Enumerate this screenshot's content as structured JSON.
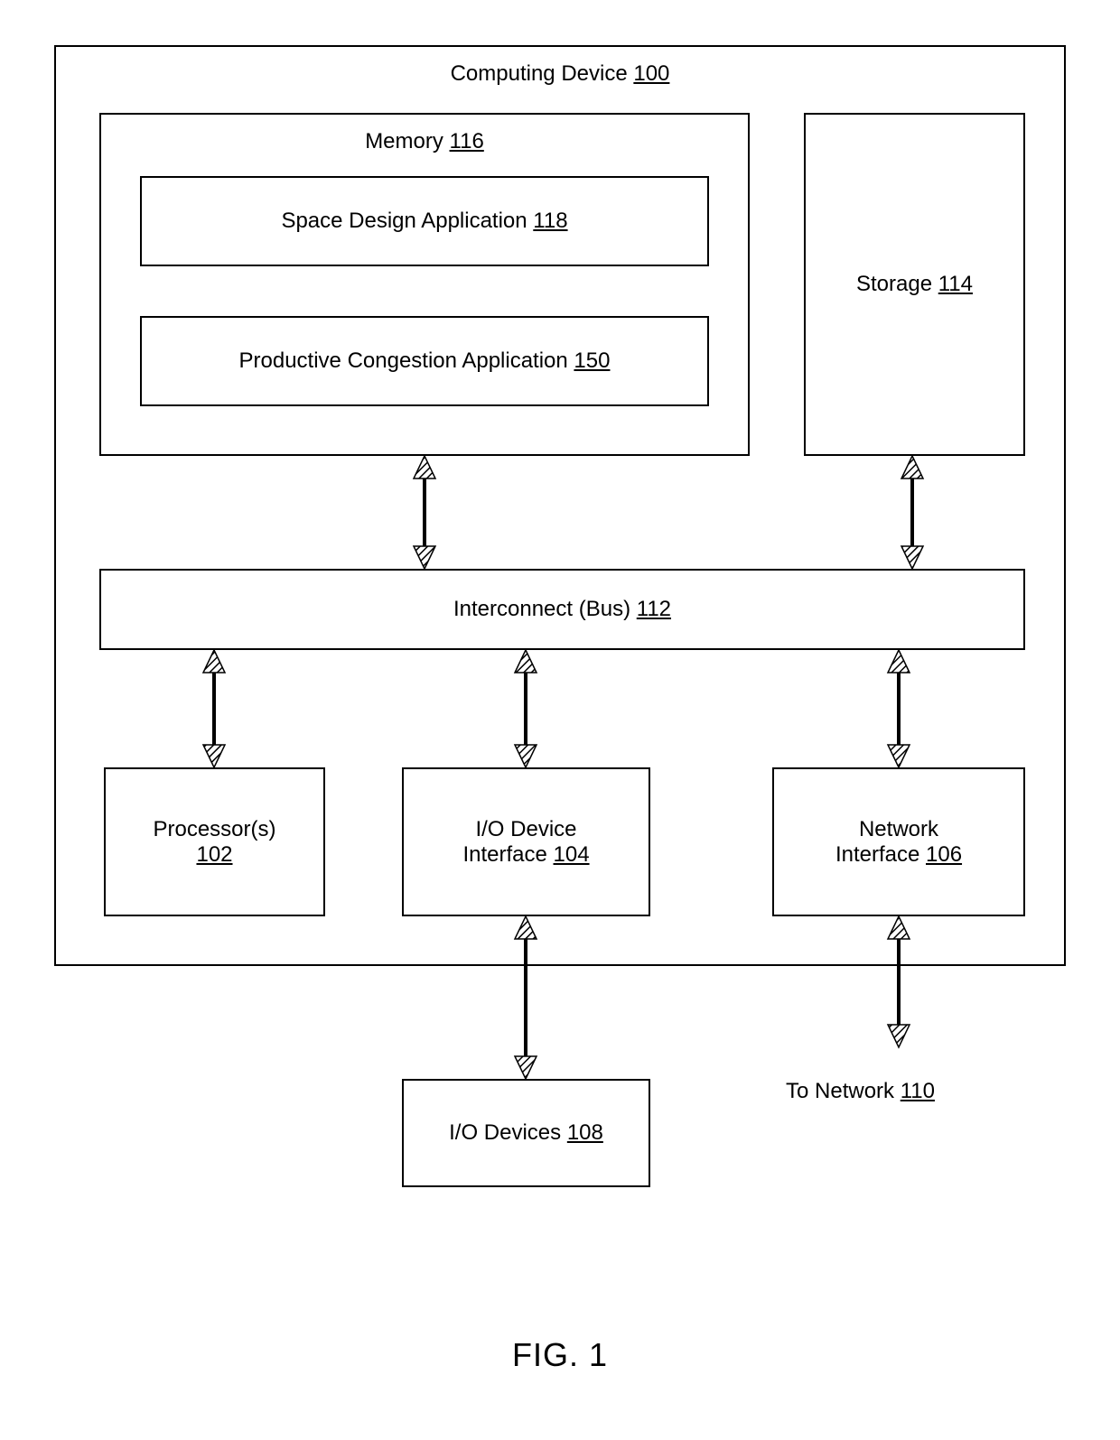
{
  "figure_caption": "FIG. 1",
  "outer": {
    "label": "Computing Device",
    "ref": "100"
  },
  "memory": {
    "label": "Memory",
    "ref": "116"
  },
  "space_design": {
    "label": "Space Design Application",
    "ref": "118"
  },
  "productive": {
    "label": "Productive Congestion Application",
    "ref": "150"
  },
  "storage": {
    "label": "Storage",
    "ref": "114"
  },
  "interconnect": {
    "label": "Interconnect (Bus)",
    "ref": "112"
  },
  "processors": {
    "label": "Processor(s)",
    "ref": "102"
  },
  "io_interface": {
    "label": "I/O Device Interface",
    "ref": "104"
  },
  "net_interface": {
    "label": "Network Interface",
    "ref": "106"
  },
  "io_devices": {
    "label": "I/O Devices",
    "ref": "108"
  },
  "to_network": {
    "label": "To Network",
    "ref": "110"
  }
}
